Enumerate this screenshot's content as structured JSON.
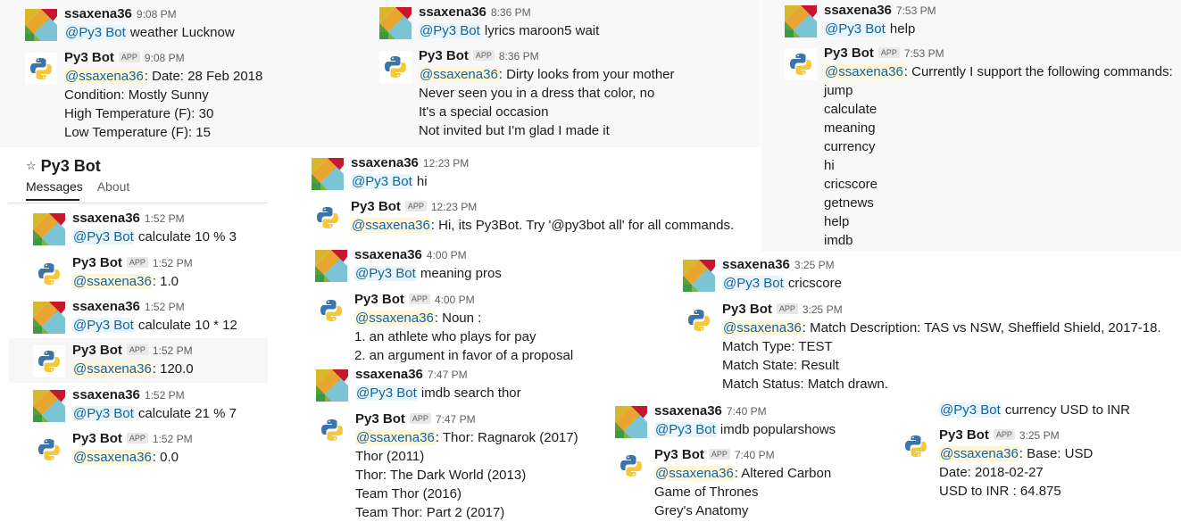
{
  "channel": {
    "title": "Py3 Bot",
    "tabs": [
      "Messages",
      "About"
    ]
  },
  "badge": "APP",
  "messages": {
    "weather_q": {
      "user": "ssaxena36",
      "time": "9:08 PM",
      "mention": "@Py3 Bot",
      "text": " weather Lucknow"
    },
    "weather_a": {
      "user": "Py3 Bot",
      "time": "9:08 PM",
      "mention": "@ssaxena36",
      "lines": [
        ": Date: 28 Feb 2018",
        "Condition: Mostly Sunny",
        "High Temperature (F): 30",
        "Low Temperature (F): 15"
      ]
    },
    "lyrics_q": {
      "user": "ssaxena36",
      "time": "8:36 PM",
      "mention": "@Py3 Bot",
      "text": " lyrics maroon5 wait"
    },
    "lyrics_a": {
      "user": "Py3 Bot",
      "time": "8:36 PM",
      "mention": "@ssaxena36",
      "lines": [
        ": Dirty looks from your mother",
        "Never seen you in a dress that color, no",
        "It's a special occasion",
        "Not invited but I'm glad I made it"
      ]
    },
    "help_q": {
      "user": "ssaxena36",
      "time": "7:53 PM",
      "mention": "@Py3 Bot",
      "text": " help"
    },
    "help_a": {
      "user": "Py3 Bot",
      "time": "7:53 PM",
      "mention": "@ssaxena36",
      "lines": [
        ": Currently I support the following commands:",
        "jump",
        "calculate",
        "meaning",
        "currency",
        "hi",
        "cricscore",
        "getnews",
        "help",
        "imdb"
      ]
    },
    "calc1_q": {
      "user": "ssaxena36",
      "time": "1:52 PM",
      "mention": "@Py3 Bot",
      "text": " calculate 10 % 3"
    },
    "calc1_a": {
      "user": "Py3 Bot",
      "time": "1:52 PM",
      "mention": "@ssaxena36",
      "text": ": 1.0"
    },
    "calc2_q": {
      "user": "ssaxena36",
      "time": "1:52 PM",
      "mention": "@Py3 Bot",
      "text": " calculate 10 * 12"
    },
    "calc2_a": {
      "user": "Py3 Bot",
      "time": "1:52 PM",
      "mention": "@ssaxena36",
      "text": ": 120.0"
    },
    "calc3_q": {
      "user": "ssaxena36",
      "time": "1:52 PM",
      "mention": "@Py3 Bot",
      "text": " calculate 21 % 7"
    },
    "calc3_a": {
      "user": "Py3 Bot",
      "time": "1:52 PM",
      "mention": "@ssaxena36",
      "text": ": 0.0"
    },
    "hi_q": {
      "user": "ssaxena36",
      "time": "12:23 PM",
      "mention": "@Py3 Bot",
      "text": " hi"
    },
    "hi_a": {
      "user": "Py3 Bot",
      "time": "12:23 PM",
      "mention": "@ssaxena36",
      "text": ": Hi, its Py3Bot. Try '@py3bot all' for all commands."
    },
    "mean_q": {
      "user": "ssaxena36",
      "time": "4:00 PM",
      "mention": "@Py3 Bot",
      "text": " meaning pros"
    },
    "mean_a": {
      "user": "Py3 Bot",
      "time": "4:00 PM",
      "mention": "@ssaxena36",
      "lines": [
        ": Noun :",
        "1. an athlete who plays for pay",
        "2. an argument in favor of a proposal"
      ]
    },
    "imdb_q": {
      "user": "ssaxena36",
      "time": "7:47 PM",
      "mention": "@Py3 Bot",
      "text": " imdb search thor"
    },
    "imdb_a": {
      "user": "Py3 Bot",
      "time": "7:47 PM",
      "mention": "@ssaxena36",
      "lines": [
        ": Thor: Ragnarok (2017)",
        "Thor (2011)",
        "Thor: The Dark World (2013)",
        "Team Thor (2016)",
        "Team Thor: Part 2 (2017)"
      ]
    },
    "cric_q": {
      "user": "ssaxena36",
      "time": "3:25 PM",
      "mention": "@Py3 Bot",
      "text": " cricscore"
    },
    "cric_a": {
      "user": "Py3 Bot",
      "time": "3:25 PM",
      "mention": "@ssaxena36",
      "lines": [
        ": Match Description: TAS vs NSW, Sheffield Shield, 2017-18.",
        "Match Type: TEST",
        "Match State: Result",
        "Match Status: Match drawn."
      ]
    },
    "pop_q": {
      "user": "ssaxena36",
      "time": "7:40 PM",
      "mention": "@Py3 Bot",
      "text": " imdb popularshows"
    },
    "pop_a": {
      "user": "Py3 Bot",
      "time": "7:40 PM",
      "mention": "@ssaxena36",
      "lines": [
        ": Altered Carbon",
        "Game of Thrones",
        "Grey's Anatomy"
      ]
    },
    "cur_q": {
      "mention": "@Py3 Bot",
      "text": " currency USD to INR"
    },
    "cur_a": {
      "user": "Py3 Bot",
      "time": "3:25 PM",
      "mention": "@ssaxena36",
      "lines": [
        ": Base: USD",
        "Date: 2018-02-27",
        "USD to INR : 64.875"
      ]
    }
  }
}
